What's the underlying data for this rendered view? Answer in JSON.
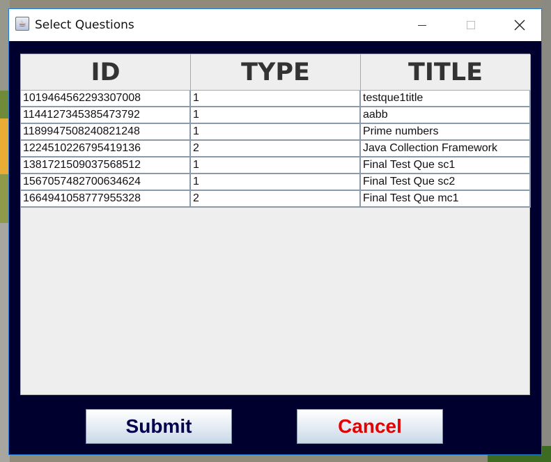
{
  "window": {
    "title": "Select Questions",
    "icon": "java-cup-icon"
  },
  "table": {
    "columns": [
      "ID",
      "TYPE",
      "TITLE"
    ],
    "rows": [
      {
        "id": "1019464562293307008",
        "type": "1",
        "title": "testque1title"
      },
      {
        "id": "1144127345385473792",
        "type": "1",
        "title": "aabb"
      },
      {
        "id": "1189947508240821248",
        "type": "1",
        "title": "Prime numbers"
      },
      {
        "id": "1224510226795419136",
        "type": "2",
        "title": "Java Collection Framework"
      },
      {
        "id": "1381721509037568512",
        "type": "1",
        "title": "Final Test Que sc1"
      },
      {
        "id": "1567057482700634624",
        "type": "1",
        "title": "Final Test Que sc2"
      },
      {
        "id": "1664941058777955328",
        "type": "2",
        "title": "Final Test Que mc1"
      }
    ]
  },
  "buttons": {
    "submit": "Submit",
    "cancel": "Cancel"
  },
  "colors": {
    "window_background": "#00002e",
    "submit_text": "#00004d",
    "cancel_text": "#e60000"
  }
}
